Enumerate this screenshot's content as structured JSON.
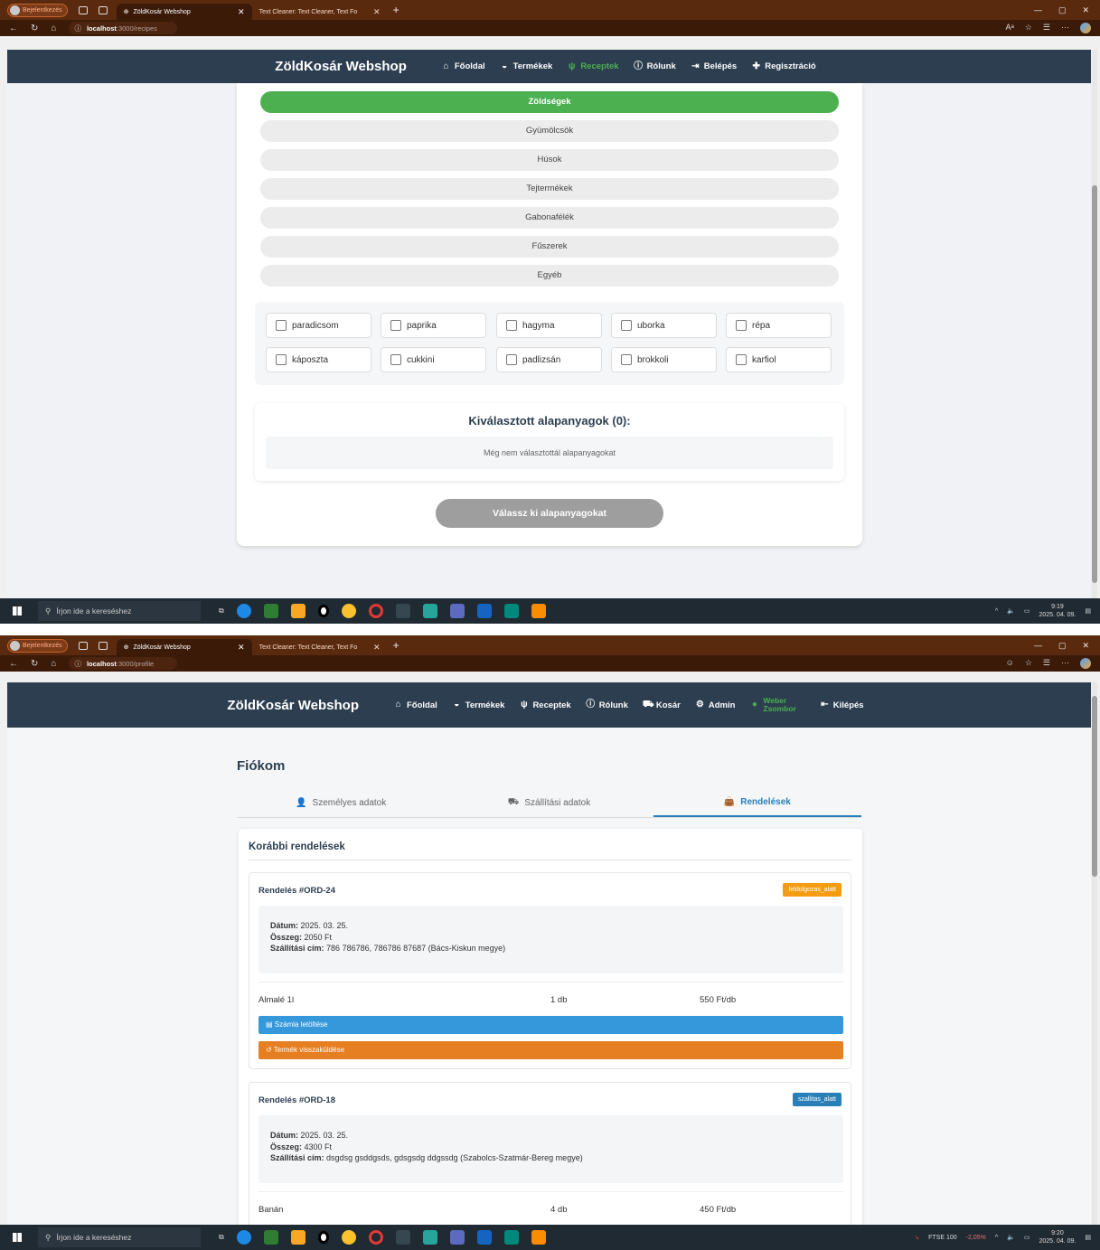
{
  "browser": {
    "profile_label": "Bejelentkezés",
    "tab_active": "ZöldKosár Webshop",
    "tab_inactive": "Text Cleaner: Text Cleaner, Text Fo",
    "url_host": "localhost",
    "url_path_1": ":3000/recipes",
    "url_path_2": ":3000/profile"
  },
  "nav": {
    "brand": "ZöldKosár Webshop",
    "home": "Főoldal",
    "products": "Termékek",
    "recipes": "Receptek",
    "about": "Rólunk",
    "login": "Belépés",
    "register": "Regisztráció",
    "cart": "Kosár",
    "admin": "Admin",
    "user_first": "Weber",
    "user_last": "Zsombor",
    "logout": "Kilépés"
  },
  "recipes": {
    "categories": [
      "Zöldségek",
      "Gyümölcsök",
      "Húsok",
      "Tejtermékek",
      "Gabonafélék",
      "Fűszerek",
      "Egyéb"
    ],
    "active_category": "Zöldségek",
    "ingredients": [
      "paradicsom",
      "paprika",
      "hagyma",
      "uborka",
      "répa",
      "káposzta",
      "cukkini",
      "padlizsán",
      "brokkoli",
      "karfiol"
    ],
    "selected_title": "Kiválasztott alapanyagok (0):",
    "selected_empty": "Még nem választottál alapanyagokat",
    "select_button": "Válassz ki alapanyagokat"
  },
  "profile": {
    "title": "Fiókom",
    "tabs": [
      "Személyes adatok",
      "Szállítási adatok",
      "Rendelések"
    ],
    "active_tab": "Rendelések",
    "orders_title": "Korábbi rendelések",
    "labels": {
      "date": "Dátum:",
      "total": "Összeg:",
      "address": "Szállítási cím:"
    },
    "invoice_button": "Számla letöltése",
    "return_button": "Termék visszaküldése",
    "orders": [
      {
        "id": "Rendelés #ORD-24",
        "status": "feldolgozas_alatt",
        "status_color": "#f39c12",
        "date": "2025. 03. 25.",
        "total": "2050 Ft",
        "address": "786 786786, 786786 87687 (Bács-Kiskun megye)",
        "item_name": "Almalé 1l",
        "item_qty": "1 db",
        "item_price": "550 Ft/db"
      },
      {
        "id": "Rendelés #ORD-18",
        "status": "szallitas_alatt",
        "status_color": "#2980b9",
        "date": "2025. 03. 25.",
        "total": "4300 Ft",
        "address": "dsgdsg gsddgsds, gdsgsdg ddgssdg (Szabolcs-Szatmár-Bereg megye)",
        "item_name": "Banán",
        "item_qty": "4 db",
        "item_price": "450 Ft/db"
      }
    ]
  },
  "taskbar": {
    "search_placeholder": "Írjon ide a kereséshez",
    "time_1": "9:19",
    "date_1": "2025. 04. 09.",
    "time_2": "9:20",
    "date_2": "2025. 04. 09.",
    "ticker": "FTSE 100",
    "ticker_change": "-2,05%"
  },
  "colors": {
    "accent_green": "#4caf50",
    "nav_bg": "#2c3e50",
    "link_blue": "#2980b9"
  }
}
